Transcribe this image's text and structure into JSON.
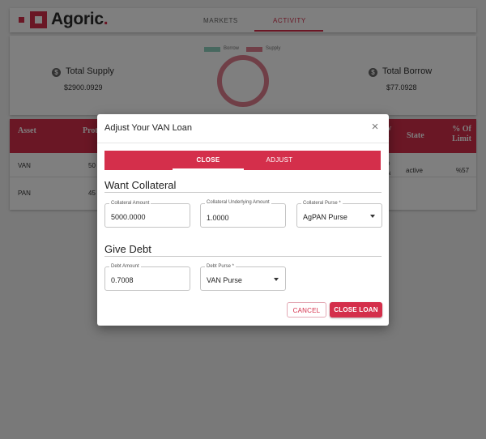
{
  "app": {
    "logo_text": "Agoric",
    "nav": {
      "markets": "MARKETS",
      "activity": "ACTIVITY"
    },
    "colors": {
      "accent": "#d42f4b",
      "borrow": "#8fd1bf",
      "supply": "#e07f8f"
    }
  },
  "summary": {
    "supply_title": "Total Supply",
    "supply_value": "$2900.0929",
    "borrow_title": "Total Borrow",
    "borrow_value": "$77.0928",
    "dollar_icon": "$",
    "legend": {
      "borrow": "Borrow",
      "supply": "Supply"
    }
  },
  "table": {
    "headers": {
      "asset": "Asset",
      "protocol": "Prot",
      "rate_top": "w",
      "rate_bottom": "e",
      "state": "State",
      "limit": "% Of Limit"
    },
    "rows": [
      {
        "asset": "VAN",
        "protocol": "50",
        "state": "active",
        "limit": "%57",
        "partial_top": "0",
        "partial_bottom": "N"
      },
      {
        "asset": "PAN",
        "protocol": "45"
      }
    ]
  },
  "modal": {
    "title": "Adjust Your VAN Loan",
    "close_icon": "×",
    "tabs": {
      "close": "CLOSE",
      "adjust": "ADJUST"
    },
    "collateral": {
      "section_title": "Want Collateral",
      "amount_label": "Collateral Amount",
      "amount_value": "5000.0000",
      "underlying_label": "Collateral Underlying Amount",
      "underlying_value": "1.0000",
      "purse_label": "Collateral Purse *",
      "purse_value": "AgPAN Purse"
    },
    "debt": {
      "section_title": "Give Debt",
      "amount_label": "Debt Amount",
      "amount_value": "0.7008",
      "purse_label": "Debt Purse *",
      "purse_value": "VAN Purse"
    },
    "buttons": {
      "cancel": "CANCEL",
      "close_loan": "CLOSE LOAN"
    }
  }
}
